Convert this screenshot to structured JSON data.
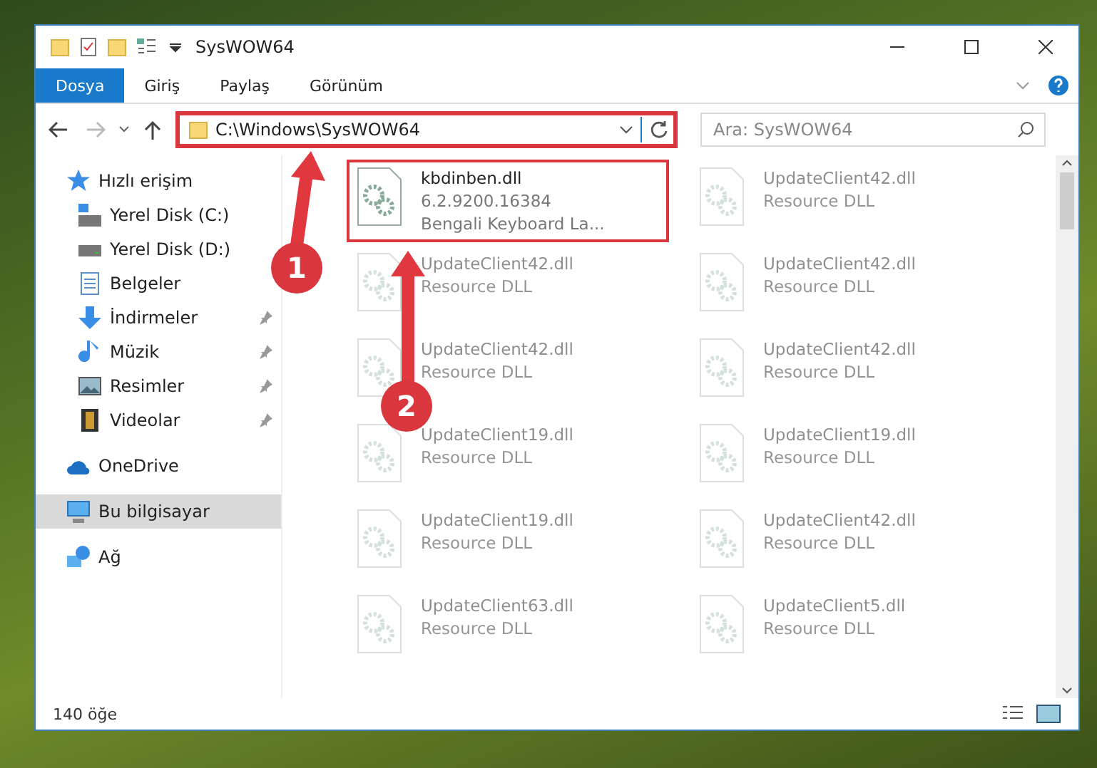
{
  "window": {
    "title": "SysWOW64"
  },
  "ribbon_tabs": [
    {
      "label": "Dosya",
      "selected": true
    },
    {
      "label": "Giriş",
      "selected": false
    },
    {
      "label": "Paylaş",
      "selected": false
    },
    {
      "label": "Görünüm",
      "selected": false
    }
  ],
  "address_bar": {
    "path": "C:\\Windows\\SysWOW64"
  },
  "search": {
    "placeholder": "Ara: SysWOW64"
  },
  "sidebar": {
    "items": [
      {
        "label": "Hızlı erişim",
        "selected": false,
        "children": [
          {
            "label": "Yerel Disk (C:)",
            "pinned": false,
            "selected": false
          },
          {
            "label": "Yerel Disk (D:)",
            "pinned": false,
            "selected": false
          },
          {
            "label": "Belgeler",
            "pinned": false,
            "selected": false
          },
          {
            "label": "İndirmeler",
            "pinned": true,
            "selected": false
          },
          {
            "label": "Müzik",
            "pinned": true,
            "selected": false
          },
          {
            "label": "Resimler",
            "pinned": true,
            "selected": false
          },
          {
            "label": "Videolar",
            "pinned": true,
            "selected": false
          }
        ]
      },
      {
        "label": "OneDrive",
        "selected": false
      },
      {
        "label": "Bu bilgisayar",
        "selected": true
      },
      {
        "label": "Ağ",
        "selected": false
      }
    ]
  },
  "files": [
    {
      "name": "kbdinben.dll",
      "version": "6.2.9200.16384",
      "description": "Bengali Keyboard La...",
      "faded": false
    },
    {
      "name": "UpdateClient42.dll",
      "description": "Resource DLL",
      "faded": true
    },
    {
      "name": "UpdateClient42.dll",
      "description": "Resource DLL",
      "faded": true
    },
    {
      "name": "UpdateClient42.dll",
      "description": "Resource DLL",
      "faded": true
    },
    {
      "name": "UpdateClient42.dll",
      "description": "Resource DLL",
      "faded": true
    },
    {
      "name": "UpdateClient42.dll",
      "description": "Resource DLL",
      "faded": true
    },
    {
      "name": "UpdateClient19.dll",
      "description": "Resource DLL",
      "faded": true
    },
    {
      "name": "UpdateClient19.dll",
      "description": "Resource DLL",
      "faded": true
    },
    {
      "name": "UpdateClient19.dll",
      "description": "Resource DLL",
      "faded": true
    },
    {
      "name": "UpdateClient42.dll",
      "description": "Resource DLL",
      "faded": true
    },
    {
      "name": "UpdateClient63.dll",
      "description": "Resource DLL",
      "faded": true
    },
    {
      "name": "UpdateClient5.dll",
      "description": "Resource DLL",
      "faded": true
    }
  ],
  "status_bar": {
    "item_count": "140 öğe"
  },
  "annotations": [
    {
      "label": "1"
    },
    {
      "label": "2"
    }
  ]
}
